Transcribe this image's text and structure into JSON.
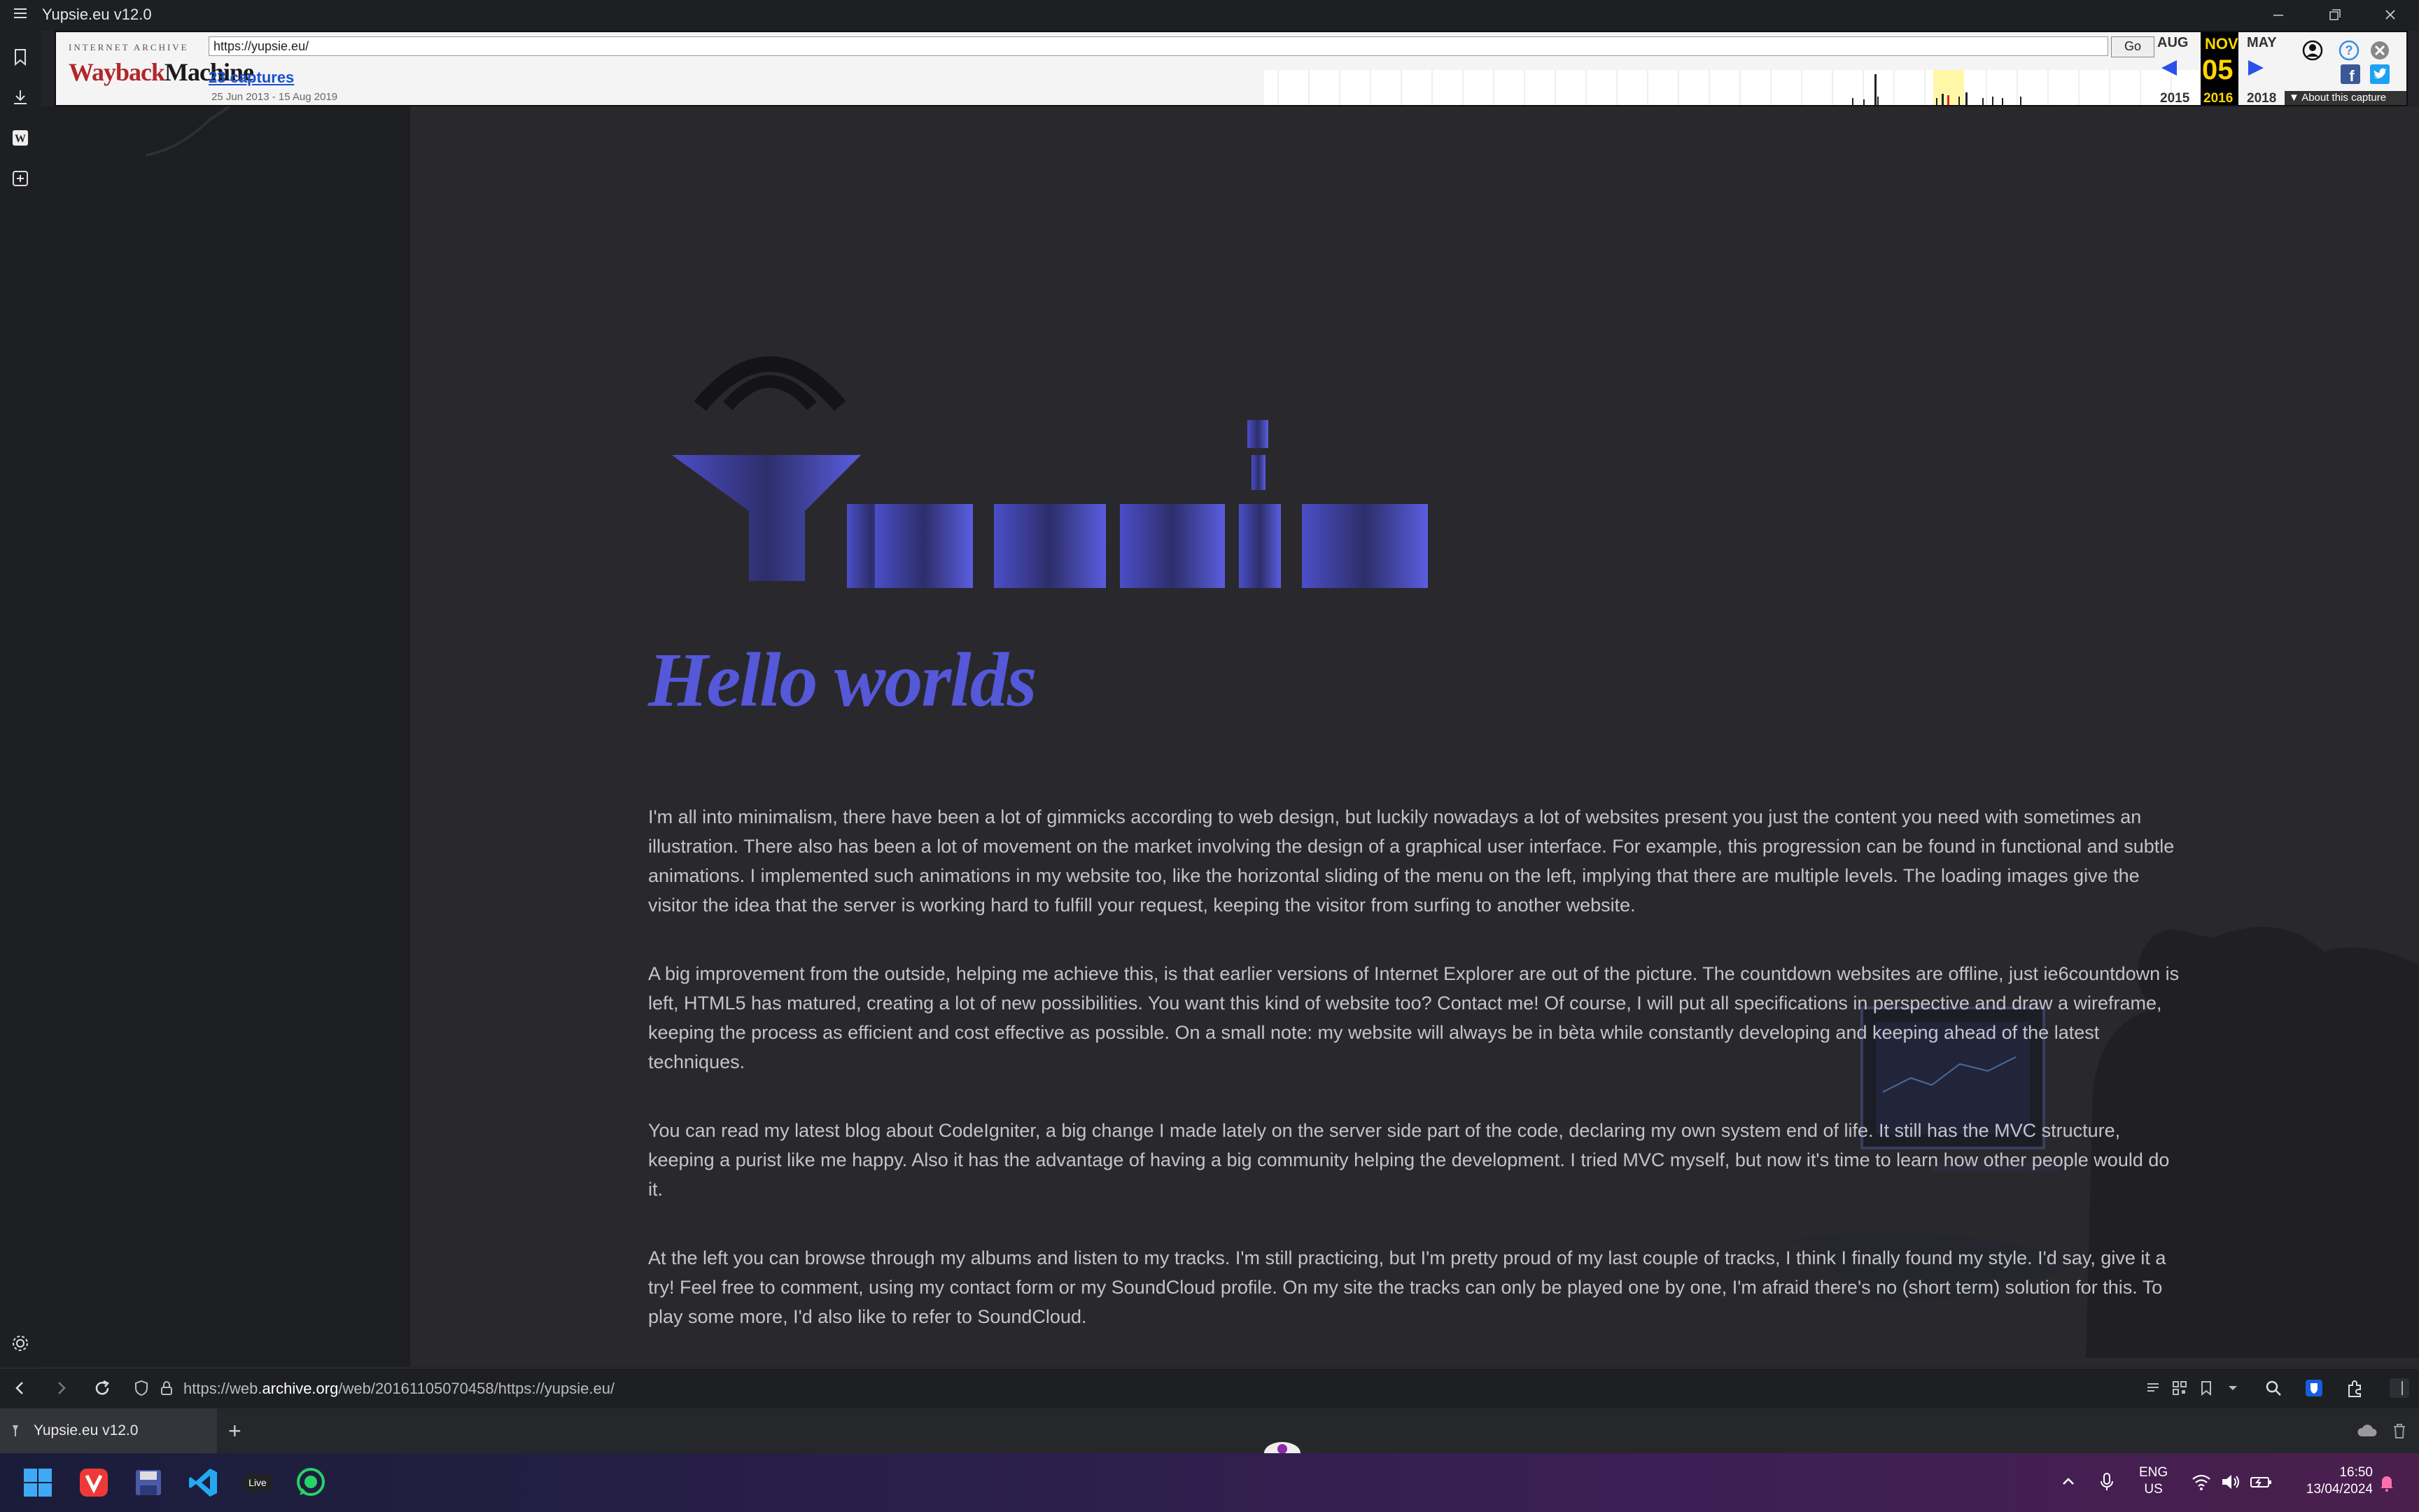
{
  "window": {
    "title": "Yupsie.eu v12.0"
  },
  "wayback": {
    "logo_top": "INTERNET ARCHIVE",
    "logo_wayback": "Wayback",
    "logo_machine": "Machine",
    "url_value": "https://yupsie.eu/",
    "go_label": "Go",
    "captures_link": "23 captures",
    "date_range": "25 Jun 2013 - 15 Aug 2019",
    "prev_month": "AUG",
    "prev_year": "2015",
    "current_month": "NOV",
    "current_day": "05",
    "current_year": "2016",
    "next_month": "MAY",
    "next_year": "2018",
    "about_label": "About this capture"
  },
  "page": {
    "logo_text": "Yupsie",
    "heading": "Hello worlds",
    "paragraphs": [
      "I'm all into minimalism, there have been a lot of gimmicks according to web design, but luckily nowadays a lot of websites present you just the content you need with sometimes an illustration. There also has been a lot of movement on the market involving the design of a graphical user interface. For example, this progression can be found in functional and subtle animations. I implemented such animations in my website too, like the horizontal sliding of the menu on the left, implying that there are multiple levels. The loading images give the visitor the idea that the server is working hard to fulfill your request, keeping the visitor from surfing to another website.",
      "A big improvement from the outside, helping me achieve this, is that earlier versions of Internet Explorer are out of the picture. The countdown websites are offline, just ie6countdown is left, HTML5 has matured, creating a lot of new possibilities. You want this kind of website too? Contact me! Of course, I will put all specifications in perspective and draw a wireframe, keeping the process as efficient and cost effective as possible. On a small note: my website will always be in bèta while constantly developing and keeping ahead of the latest techniques.",
      "You can read my latest blog about CodeIgniter, a big change I made lately on the server side part of the code, declaring my own system end of life. It still has the MVC structure, keeping a purist like me happy. Also it has the advantage of having a big community helping the development. I tried MVC myself, but now it's time to learn how other people would do it.",
      "At the left you can browse through my albums and listen to my tracks. I'm still practicing, but I'm pretty proud of my last couple of tracks, I think I finally found my style. I'd say, give it a try! Feel free to comment, using my contact form or my SoundCloud profile. On my site the tracks can only be played one by one, I'm afraid there's no (short term) solution for this. To play some more, I'd also like to refer to SoundCloud."
    ]
  },
  "navbar": {
    "url_prefix": "https://web.",
    "url_domain": "archive.org",
    "url_rest": "/web/20161105070458/https://yupsie.eu/"
  },
  "tabs": [
    {
      "label": "Yupsie.eu v12.0"
    }
  ],
  "taskbar": {
    "apps": [
      "windows-start",
      "vivaldi",
      "save-app",
      "vscode",
      "live-app",
      "whatsapp"
    ],
    "lang_line1": "ENG",
    "lang_line2": "US",
    "time": "16:50",
    "date": "13/04/2024"
  },
  "colors": {
    "accent": "#5558d8",
    "wayback_red": "#b1272b",
    "wayback_highlight": "#ffd700"
  }
}
